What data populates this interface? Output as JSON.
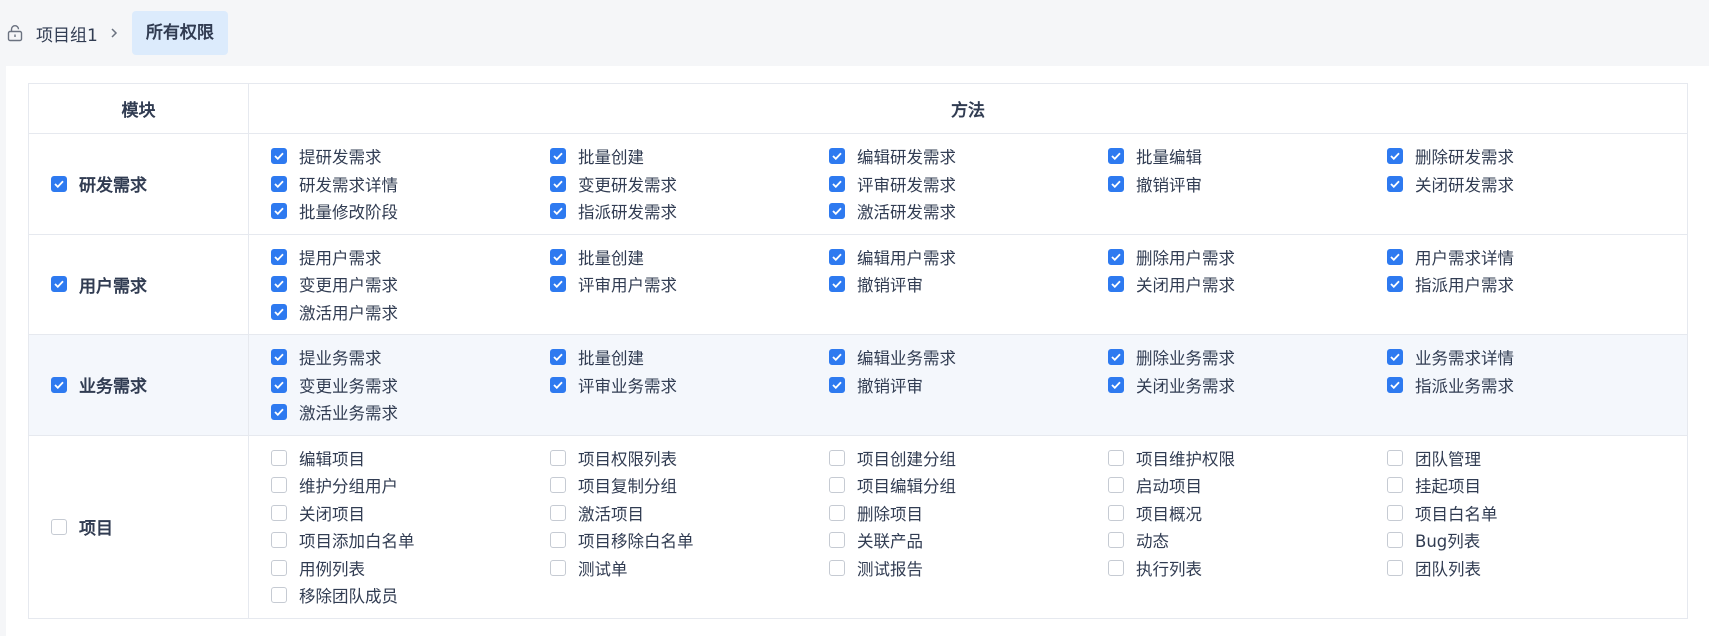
{
  "breadcrumb": {
    "parent": "项目组1",
    "current": "所有权限"
  },
  "table": {
    "col_module": "模块",
    "col_methods": "方法"
  },
  "modules": [
    {
      "name": "研发需求",
      "checked": true,
      "highlight": false,
      "methods": [
        {
          "label": "提研发需求",
          "checked": true
        },
        {
          "label": "批量创建",
          "checked": true
        },
        {
          "label": "编辑研发需求",
          "checked": true
        },
        {
          "label": "批量编辑",
          "checked": true
        },
        {
          "label": "删除研发需求",
          "checked": true
        },
        {
          "label": "研发需求详情",
          "checked": true
        },
        {
          "label": "变更研发需求",
          "checked": true
        },
        {
          "label": "评审研发需求",
          "checked": true
        },
        {
          "label": "撤销评审",
          "checked": true
        },
        {
          "label": "关闭研发需求",
          "checked": true
        },
        {
          "label": "批量修改阶段",
          "checked": true
        },
        {
          "label": "指派研发需求",
          "checked": true
        },
        {
          "label": "激活研发需求",
          "checked": true
        }
      ]
    },
    {
      "name": "用户需求",
      "checked": true,
      "highlight": false,
      "methods": [
        {
          "label": "提用户需求",
          "checked": true
        },
        {
          "label": "批量创建",
          "checked": true
        },
        {
          "label": "编辑用户需求",
          "checked": true
        },
        {
          "label": "删除用户需求",
          "checked": true
        },
        {
          "label": "用户需求详情",
          "checked": true
        },
        {
          "label": "变更用户需求",
          "checked": true
        },
        {
          "label": "评审用户需求",
          "checked": true
        },
        {
          "label": "撤销评审",
          "checked": true
        },
        {
          "label": "关闭用户需求",
          "checked": true
        },
        {
          "label": "指派用户需求",
          "checked": true
        },
        {
          "label": "激活用户需求",
          "checked": true
        }
      ]
    },
    {
      "name": "业务需求",
      "checked": true,
      "highlight": true,
      "methods": [
        {
          "label": "提业务需求",
          "checked": true
        },
        {
          "label": "批量创建",
          "checked": true
        },
        {
          "label": "编辑业务需求",
          "checked": true
        },
        {
          "label": "删除业务需求",
          "checked": true
        },
        {
          "label": "业务需求详情",
          "checked": true
        },
        {
          "label": "变更业务需求",
          "checked": true
        },
        {
          "label": "评审业务需求",
          "checked": true
        },
        {
          "label": "撤销评审",
          "checked": true
        },
        {
          "label": "关闭业务需求",
          "checked": true
        },
        {
          "label": "指派业务需求",
          "checked": true
        },
        {
          "label": "激活业务需求",
          "checked": true
        }
      ]
    },
    {
      "name": "项目",
      "checked": false,
      "highlight": false,
      "methods": [
        {
          "label": "编辑项目",
          "checked": false
        },
        {
          "label": "项目权限列表",
          "checked": false
        },
        {
          "label": "项目创建分组",
          "checked": false
        },
        {
          "label": "项目维护权限",
          "checked": false
        },
        {
          "label": "团队管理",
          "checked": false
        },
        {
          "label": "维护分组用户",
          "checked": false
        },
        {
          "label": "项目复制分组",
          "checked": false
        },
        {
          "label": "项目编辑分组",
          "checked": false
        },
        {
          "label": "启动项目",
          "checked": false
        },
        {
          "label": "挂起项目",
          "checked": false
        },
        {
          "label": "关闭项目",
          "checked": false
        },
        {
          "label": "激活项目",
          "checked": false
        },
        {
          "label": "删除项目",
          "checked": false
        },
        {
          "label": "项目概况",
          "checked": false
        },
        {
          "label": "项目白名单",
          "checked": false
        },
        {
          "label": "项目添加白名单",
          "checked": false
        },
        {
          "label": "项目移除白名单",
          "checked": false
        },
        {
          "label": "关联产品",
          "checked": false
        },
        {
          "label": "动态",
          "checked": false
        },
        {
          "label": "Bug列表",
          "checked": false
        },
        {
          "label": "用例列表",
          "checked": false
        },
        {
          "label": "测试单",
          "checked": false
        },
        {
          "label": "测试报告",
          "checked": false
        },
        {
          "label": "执行列表",
          "checked": false
        },
        {
          "label": "团队列表",
          "checked": false
        },
        {
          "label": "移除团队成员",
          "checked": false
        }
      ]
    }
  ],
  "icons": {
    "lock": "lock-icon",
    "chevron": "chevron-right-icon",
    "check": "check-icon"
  },
  "colors": {
    "accent": "#2e7af0",
    "crumb_active_bg": "#dcebfc",
    "highlight_row": "#f4f7fc"
  }
}
